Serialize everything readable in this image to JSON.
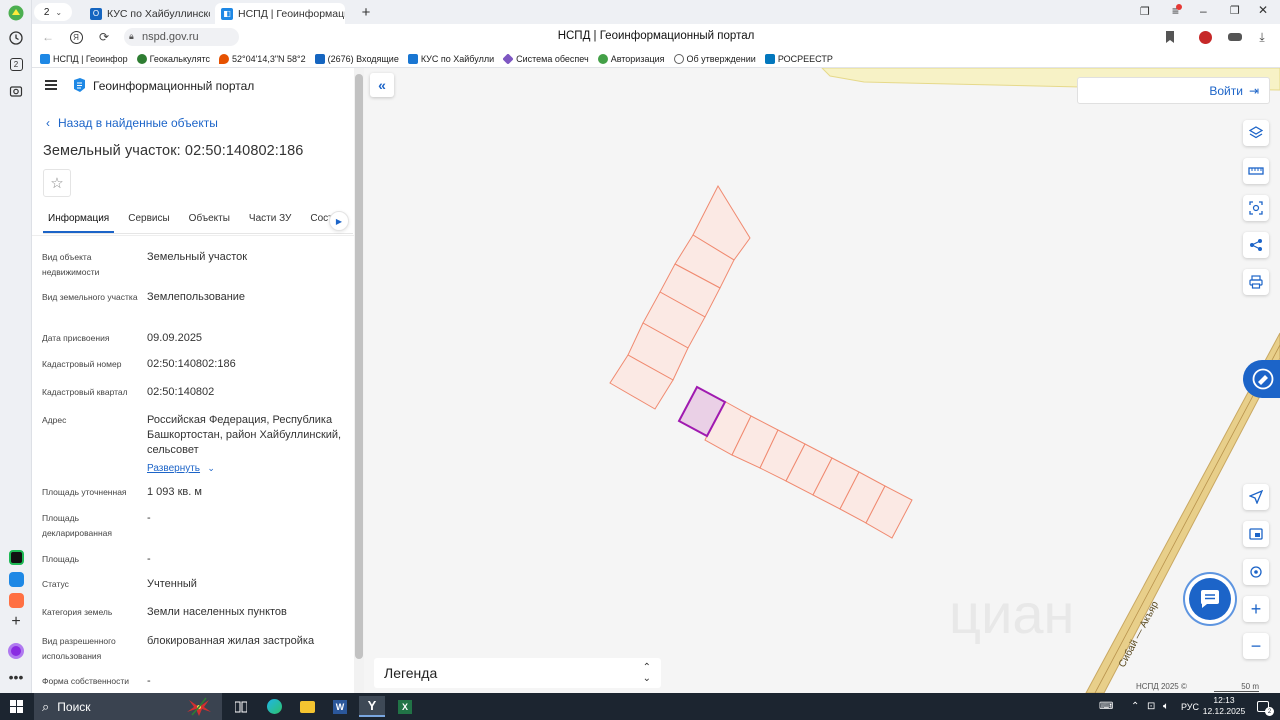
{
  "browser": {
    "tab_counter": "2",
    "tabs": [
      {
        "title": "КУС по Хайбуллинскому р",
        "active": false
      },
      {
        "title": "НСПД | Геоинформацио",
        "active": true
      }
    ],
    "url": "nspd.gov.ru",
    "page_title": "НСПД | Геоинформационный портал",
    "bookmarks": [
      {
        "label": "НСПД | Геоинфор",
        "color": "#1e88e5"
      },
      {
        "label": "Геокалькулятс",
        "color": "#2e7d32"
      },
      {
        "label": "52°04'14,3\"N 58°2",
        "color": "#e65100"
      },
      {
        "label": "(2676) Входящие",
        "color": "#1565c0"
      },
      {
        "label": "КУС по Хайбулли",
        "color": "#1976d2"
      },
      {
        "label": "Система обеспеч",
        "color": "#7e57c2"
      },
      {
        "label": "Авторизация",
        "color": "#43a047"
      },
      {
        "label": "Об утверждении",
        "color": "#616161"
      },
      {
        "label": "РОСРЕЕСТР",
        "color": "#0277bd"
      }
    ]
  },
  "panel": {
    "portal_name": "Геоинформационный портал",
    "back_link": "Назад в найденные объекты",
    "title": "Земельный участок: 02:50:140802:186",
    "tabs": [
      "Информация",
      "Сервисы",
      "Объекты",
      "Части ЗУ",
      "Соста"
    ],
    "fields": [
      {
        "label": "Вид объекта недвижимости",
        "value": "Земельный участок"
      },
      {
        "label": "Вид земельного участка",
        "value": "Землепользование"
      },
      {
        "label": "Дата присвоения",
        "value": "09.09.2025"
      },
      {
        "label": "Кадастровый номер",
        "value": "02:50:140802:186"
      },
      {
        "label": "Кадастровый квартал",
        "value": "02:50:140802"
      },
      {
        "label": "Адрес",
        "value": "Российская Федерация, Республика Башкортостан, район Хайбуллинский, сельсовет"
      },
      {
        "label": "Площадь уточненная",
        "value": "1 093 кв. м"
      },
      {
        "label": "Площадь декларированная",
        "value": "-"
      },
      {
        "label": "Площадь",
        "value": "-"
      },
      {
        "label": "Статус",
        "value": "Учтенный"
      },
      {
        "label": "Категория земель",
        "value": "Земли населенных пунктов"
      },
      {
        "label": "Вид разрешенного использования",
        "value": "блокированная жилая застройка"
      },
      {
        "label": "Форма собственности",
        "value": "-"
      }
    ],
    "expand_label": "Развернуть"
  },
  "map": {
    "login_label": "Войти",
    "legend_label": "Легенда",
    "road_label": "Сибай — Акъяр",
    "watermark": "циан",
    "copyright": "НСПД 2025 ©",
    "scale_label": "50 m",
    "colors": {
      "parcel_stroke": "#f08a70",
      "parcel_fill": "#fbe9e4",
      "selected_stroke": "#a01ab0",
      "selected_fill": "#ead0e6",
      "road": "#e8cf8a",
      "field": "#f7f2c6",
      "accent": "#1c64c8"
    }
  },
  "taskbar": {
    "search_label": "Поиск",
    "lang": "РУС",
    "time": "12:13",
    "date": "12.12.2025"
  }
}
